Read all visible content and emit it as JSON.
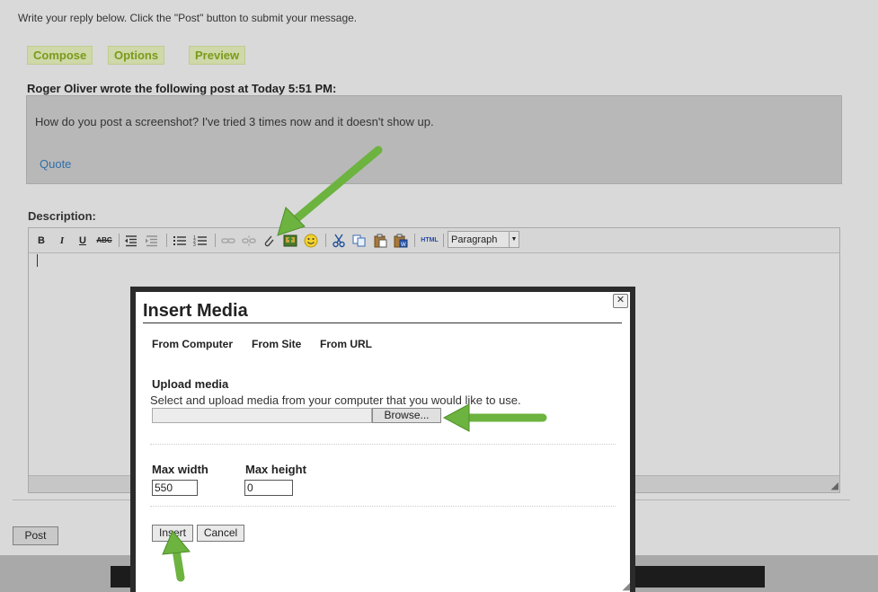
{
  "page": {
    "instructions": "Write your reply below. Click the \"Post\" button to submit your message.",
    "tabs": [
      "Compose",
      "Options",
      "Preview"
    ],
    "quote": {
      "heading": "Roger Oliver wrote the following post at Today 5:51 PM:",
      "text": "How do you post a screenshot? I've tried 3 times now and it doesn't show up.",
      "link": "Quote"
    },
    "description_label": "Description:",
    "toolbar": {
      "bold": "B",
      "italic": "I",
      "underline": "U",
      "strikethrough": "ABC",
      "html": "HTML",
      "format_value": "Paragraph",
      "format_arrow": "▼"
    },
    "post_button": "Post"
  },
  "modal": {
    "close": "✕",
    "title": "Insert Media",
    "tabs": [
      "From Computer",
      "From Site",
      "From URL"
    ],
    "upload_heading": "Upload media",
    "upload_desc": "Select and upload media from your computer that you would like to use.",
    "browse": "Browse...",
    "max_width_label": "Max width",
    "max_width_value": "550",
    "max_height_label": "Max height",
    "max_height_value": "0",
    "insert": "Insert",
    "cancel": "Cancel"
  },
  "colors": {
    "annotation_arrow": "#6db33f",
    "tab_text": "#7a9a1a",
    "link": "#2f6fa8"
  }
}
